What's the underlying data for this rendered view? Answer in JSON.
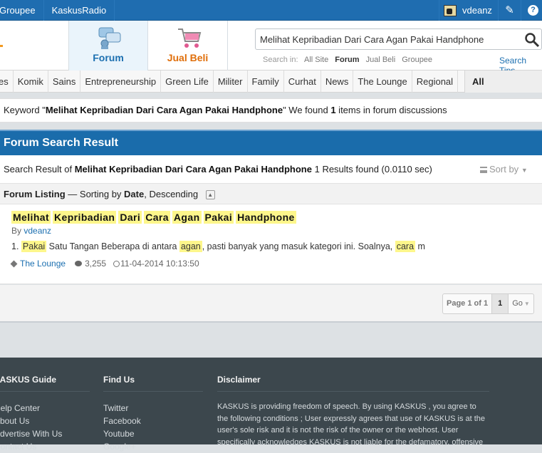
{
  "topbar": {
    "links": [
      "Groupee",
      "KaskusRadio"
    ],
    "username": "vdeanz",
    "edit_icon": "pencil-icon",
    "help_label": "?"
  },
  "header": {
    "nav_forum": "Forum",
    "nav_jual_beli": "Jual Beli",
    "search_value": "Melihat Kepribadian Dari Cara Agan Pakai Handphone",
    "search_in_label": "Search in:",
    "search_in_options": [
      "All Site",
      "Forum",
      "Jual Beli",
      "Groupee"
    ],
    "search_tips": "Search Tips"
  },
  "categories": {
    "items": [
      "es",
      "Komik",
      "Sains",
      "Entrepreneurship",
      "Green Life",
      "Militer",
      "Family",
      "Curhat",
      "News",
      "The Lounge",
      "Regional"
    ],
    "all_label": "All categories"
  },
  "keyword_bar": {
    "prefix": "Keyword \"",
    "keyword": "Melihat Kepribadian Dari Cara Agan Pakai Handphone",
    "mid": "\" We found ",
    "count": "1",
    "suffix": " items in forum discussions"
  },
  "results": {
    "heading": "Forum Search Result",
    "summary_prefix": "Search Result of ",
    "summary_query": "Melihat Kepribadian Dari Cara Agan Pakai Handphone",
    "summary_suffix": " 1 Results found (0.0110 sec)",
    "sort_by": "Sort by",
    "listing_label": "Forum Listing",
    "listing_sep": " — Sorting by ",
    "listing_key": "Date",
    "listing_order": ", Descending",
    "item": {
      "title_words": [
        "Melihat",
        "Kepribadian",
        "Dari",
        "Cara",
        "Agan",
        "Pakai",
        "Handphone"
      ],
      "by_label": "By ",
      "author": "vdeanz",
      "snippet_num": "1.",
      "snippet_hl1": "Pakai",
      "snippet_t1": " Satu Tangan Beberapa di antara ",
      "snippet_hl2": "agan",
      "snippet_t2": ", pasti banyak yang masuk kategori ini. Soalnya, ",
      "snippet_hl3": "cara",
      "snippet_t3": " m",
      "category": "The Lounge",
      "views": "3,255",
      "date": "11-04-2014 10:13:50"
    }
  },
  "pager": {
    "label": "Page 1 of 1",
    "current": "1",
    "go": "Go"
  },
  "footer": {
    "col1_title": "KASKUS Guide",
    "col1_items": [
      "Help Center",
      "About Us",
      "Advertise With Us",
      "Contact Us"
    ],
    "col2_title": "Find Us",
    "col2_items": [
      "Twitter",
      "Facebook",
      "Youtube",
      "Google+"
    ],
    "col3_title": "Disclaimer",
    "disclaimer": "KASKUS is providing freedom of speech. By using KASKUS , you agree to the following conditions ; User expressly agrees that use of KASKUS is at the user's sole risk and it is not the risk of the owner or the webhost. User specifically acknowledges KASKUS is not liable for the defamatory, offensive"
  }
}
